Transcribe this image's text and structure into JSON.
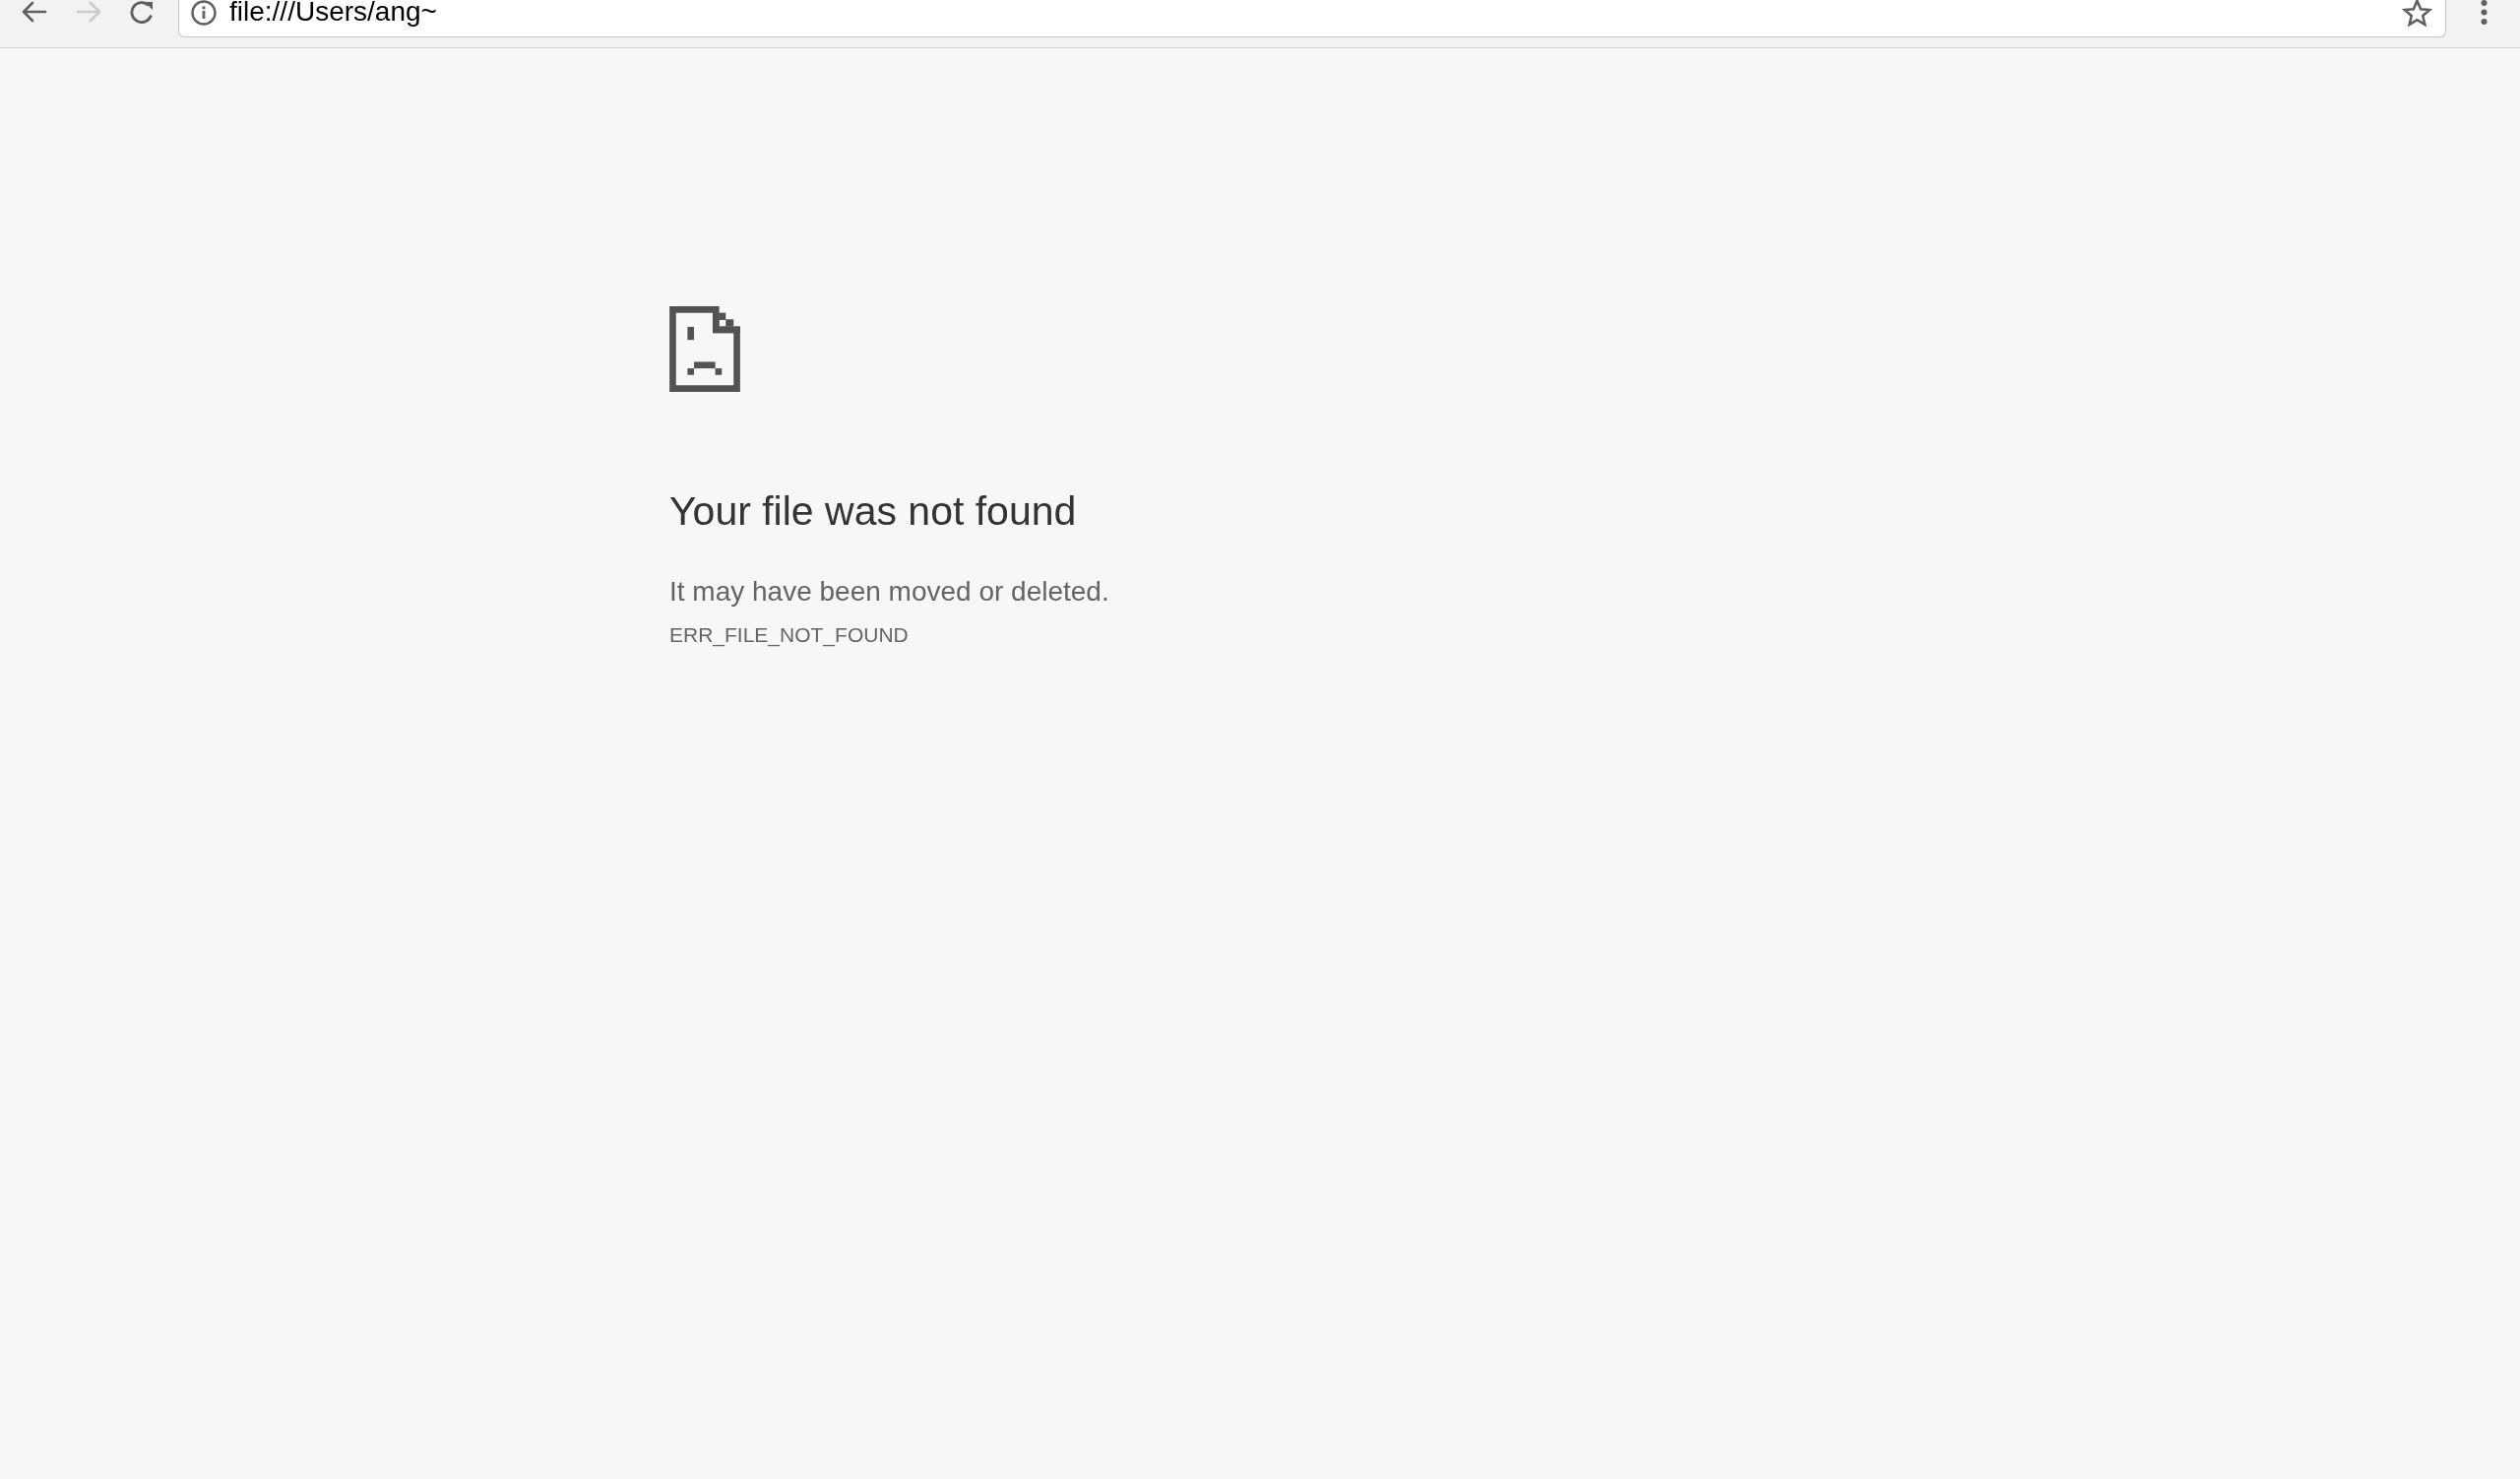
{
  "toolbar": {
    "back": {
      "disabled": false
    },
    "forward": {
      "disabled": true
    },
    "address_bar": {
      "value": "file:///Users/ang~"
    },
    "bookmark": {
      "starred": false
    }
  },
  "error": {
    "title": "Your file was not found",
    "message": "It may have been moved or deleted.",
    "code": "ERR_FILE_NOT_FOUND"
  }
}
